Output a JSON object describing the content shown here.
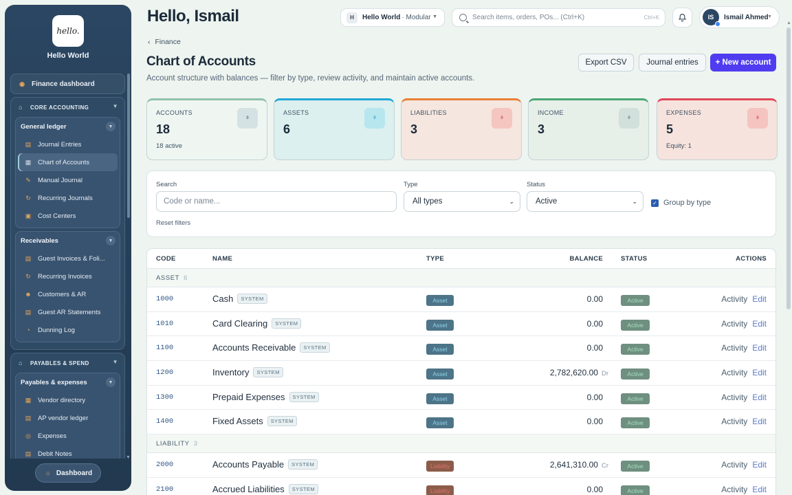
{
  "sidebar": {
    "logo_text": "hello.",
    "brand": "Hello World",
    "finance_dashboard": "Finance dashboard",
    "sections": [
      {
        "title": "CORE ACCOUNTING",
        "groups": [
          {
            "title": "General ledger",
            "items": [
              "Journal Entries",
              "Chart of Accounts",
              "Manual Journal",
              "Recurring Journals",
              "Cost Centers"
            ]
          },
          {
            "title": "Receivables",
            "items": [
              "Guest Invoices & Foli...",
              "Recurring Invoices",
              "Customers & AR",
              "Guest AR Statements",
              "Dunning Log"
            ]
          }
        ]
      },
      {
        "title": "PAYABLES & SPEND",
        "groups": [
          {
            "title": "Payables & expenses",
            "items": [
              "Vendor directory",
              "AP vendor ledger",
              "Expenses",
              "Debit Notes"
            ]
          }
        ]
      }
    ],
    "dashboard_button": "Dashboard"
  },
  "topbar": {
    "greeting": "Hello, Ismail",
    "workspace_badge": "H",
    "workspace_name": "Hello World",
    "workspace_sub": "· Modular",
    "search_placeholder": "Search items, orders, POs... (Ctrl+K)",
    "search_shortcut": "Ctrl+K",
    "user_initials": "IS",
    "user_name": "Ismail Ahmed"
  },
  "header": {
    "breadcrumb": "Finance",
    "title": "Chart of Accounts",
    "subtitle": "Account structure with balances — filter by type, review activity, and maintain active accounts.",
    "export_csv": "Export CSV",
    "journal_entries": "Journal entries",
    "new_account": "+ New account"
  },
  "cards": [
    {
      "label": "ACCOUNTS",
      "value": "18",
      "sub": "18 active",
      "icon": "0"
    },
    {
      "label": "ASSETS",
      "value": "6",
      "sub": "",
      "icon": "0"
    },
    {
      "label": "LIABILITIES",
      "value": "3",
      "sub": "",
      "icon": "0"
    },
    {
      "label": "INCOME",
      "value": "3",
      "sub": "",
      "icon": "0"
    },
    {
      "label": "EXPENSES",
      "value": "5",
      "sub": "Equity: 1",
      "icon": "0"
    }
  ],
  "filters": {
    "search_label": "Search",
    "search_placeholder": "Code or name...",
    "type_label": "Type",
    "type_value": "All types",
    "status_label": "Status",
    "status_value": "Active",
    "group_by_type": "Group by type",
    "reset": "Reset filters"
  },
  "table": {
    "headers": {
      "code": "CODE",
      "name": "NAME",
      "type": "TYPE",
      "balance": "BALANCE",
      "status": "STATUS",
      "actions": "ACTIONS"
    },
    "system_tag": "SYSTEM",
    "activity": "Activity",
    "edit": "Edit",
    "groups": [
      {
        "label": "ASSET",
        "count": "6",
        "rows": [
          {
            "code": "1000",
            "name": "Cash",
            "type": "Asset",
            "balance": "0.00",
            "drcr": "",
            "status": "Active"
          },
          {
            "code": "1010",
            "name": "Card Clearing",
            "type": "Asset",
            "balance": "0.00",
            "drcr": "",
            "status": "Active"
          },
          {
            "code": "1100",
            "name": "Accounts Receivable",
            "type": "Asset",
            "balance": "0.00",
            "drcr": "",
            "status": "Active"
          },
          {
            "code": "1200",
            "name": "Inventory",
            "type": "Asset",
            "balance": "2,782,620.00",
            "drcr": "Dr",
            "status": "Active"
          },
          {
            "code": "1300",
            "name": "Prepaid Expenses",
            "type": "Asset",
            "balance": "0.00",
            "drcr": "",
            "status": "Active"
          },
          {
            "code": "1400",
            "name": "Fixed Assets",
            "type": "Asset",
            "balance": "0.00",
            "drcr": "",
            "status": "Active"
          }
        ]
      },
      {
        "label": "LIABILITY",
        "count": "3",
        "rows": [
          {
            "code": "2000",
            "name": "Accounts Payable",
            "type": "Liability",
            "balance": "2,641,310.00",
            "drcr": "Cr",
            "status": "Active"
          },
          {
            "code": "2100",
            "name": "Accrued Liabilities",
            "type": "Liability",
            "balance": "0.00",
            "drcr": "",
            "status": "Active"
          }
        ]
      }
    ]
  }
}
